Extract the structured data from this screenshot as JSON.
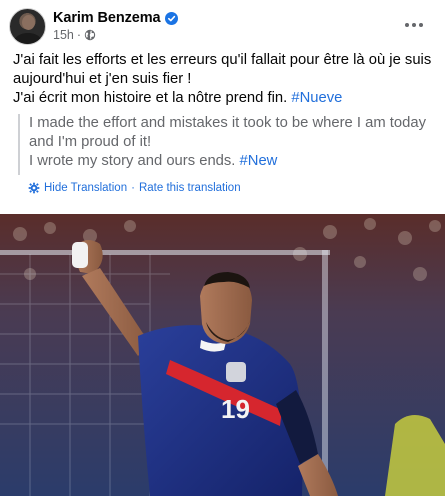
{
  "post": {
    "author": "Karim Benzema",
    "verified": true,
    "time": "15h",
    "separator": "·",
    "audience_icon": "globe-icon",
    "more_icon": "more-options-icon",
    "text_line1": "J'ai fait les efforts et les erreurs qu'il fallait pour être là où je suis aujourd'hui et j'en suis fier !",
    "text_line2_prefix": "J'ai écrit mon histoire et la nôtre prend fin. ",
    "text_hashtag": "#Nueve",
    "translation_line1": "I made the effort and mistakes it took to be where I am today and I'm proud of it!",
    "translation_line2_prefix": "I wrote my story and ours ends. ",
    "translation_hashtag": "#New",
    "hide_translation": "Hide Translation",
    "links_separator": "·",
    "rate_translation": "Rate this translation",
    "photo": {
      "description_icon": "football-player-photo",
      "jersey_number": "19"
    }
  },
  "colors": {
    "link_blue": "#216fdb",
    "verified_blue": "#1b74e4",
    "secondary_text": "#65676b",
    "jersey_navy": "#1f2f7a",
    "jersey_red": "#d6262e"
  }
}
